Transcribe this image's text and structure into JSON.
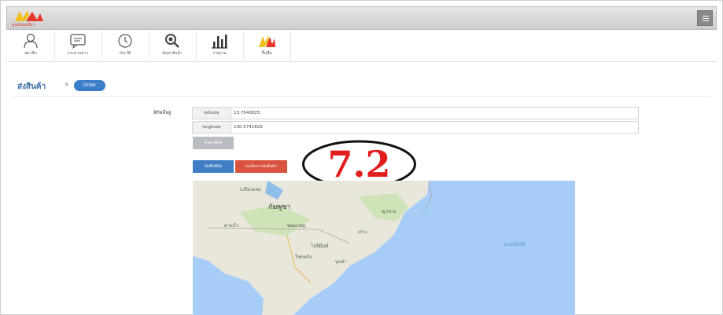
{
  "app": {
    "logo_text": "ศูนย์ท่องเที่ยว"
  },
  "toolbar": {
    "items": [
      {
        "label": "สมาชิก",
        "icon": "user-icon"
      },
      {
        "label": "กระดานข่าว",
        "icon": "chat-icon"
      },
      {
        "label": "ประวัติ",
        "icon": "clock-icon"
      },
      {
        "label": "ค้นหาสินค้า",
        "icon": "search-icon"
      },
      {
        "label": "รายงาน",
        "icon": "bar-chart-icon"
      },
      {
        "label": "ขึ้นชื่อ",
        "icon": "brand-logo-icon"
      }
    ]
  },
  "breadcrumb": {
    "title": "ส่งสินค้า",
    "separator": "»",
    "badge": "Order"
  },
  "form": {
    "location_label": "พิกัดที่อยู่",
    "latitude_label": "latitude",
    "latitude_value": "13.7540825",
    "longitude_label": "longitude",
    "longitude_value": "100.5741829",
    "locate_button": "ค้นหาพิกัด",
    "save_button": "บันทึกพิกัด",
    "cancel_button": "ยกเลิกการส่งสินค้า"
  },
  "annotation": {
    "text": "7.2",
    "color": "#e11d1d"
  },
  "map": {
    "labels": {
      "country": "กัมพูชา",
      "region1": "พนมเปญ",
      "region2": "โฮจิมินห์",
      "region3": "ญาจาง",
      "region4": "เกาะ",
      "sea": "ทะเลจีนใต้",
      "city1": "เปรียวแหง",
      "city2": "โซกตรัง",
      "city3": "ตาแก้ว",
      "city4": "วุงเต่า"
    },
    "colors": {
      "water": "#a6cdf7",
      "land": "#e9e6dc"
    }
  }
}
